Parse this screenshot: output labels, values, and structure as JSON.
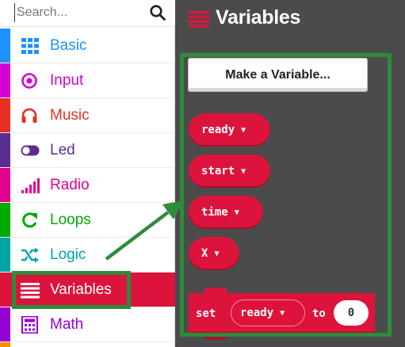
{
  "search": {
    "placeholder": "Search...",
    "icon": "search-icon"
  },
  "categories": [
    {
      "label": "Basic",
      "color": "#1e90ff",
      "icon": "grid-icon"
    },
    {
      "label": "Input",
      "color": "#d400d4",
      "icon": "radio-target-icon"
    },
    {
      "label": "Music",
      "color": "#e63022",
      "icon": "headphones-icon"
    },
    {
      "label": "Led",
      "color": "#5c2d91",
      "icon": "toggle-icon"
    },
    {
      "label": "Radio",
      "color": "#e3008c",
      "icon": "signal-bars-icon"
    },
    {
      "label": "Loops",
      "color": "#00aa00",
      "icon": "refresh-icon"
    },
    {
      "label": "Logic",
      "color": "#00a4a6",
      "icon": "shuffle-icon"
    },
    {
      "label": "Variables",
      "color": "#dc143c",
      "icon": "list-icon",
      "selected": true
    },
    {
      "label": "Math",
      "color": "#9400d3",
      "icon": "calculator-icon"
    }
  ],
  "flyout": {
    "title": "Variables",
    "title_icon": "list-icon",
    "make_variable_label": "Make a Variable...",
    "variables": [
      "ready",
      "start",
      "time",
      "X"
    ],
    "set_block": {
      "keyword": "set",
      "variable": "ready",
      "to_word": "to",
      "value": "0"
    }
  },
  "colors": {
    "variables": "#dc143c",
    "flyout_background": "#4b4b4b",
    "highlight": "#2e8b3a"
  }
}
